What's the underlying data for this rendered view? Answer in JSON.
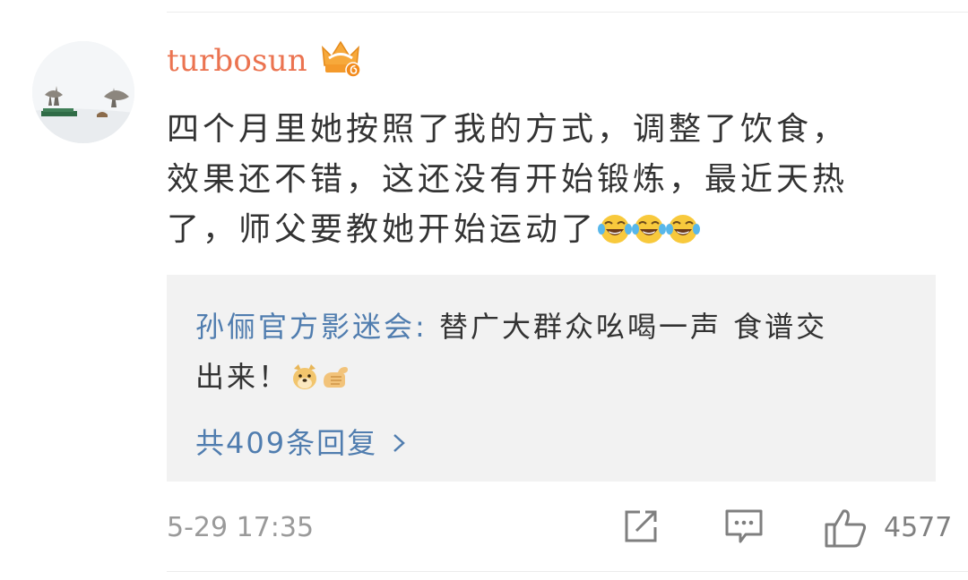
{
  "comment": {
    "username": "turbosun",
    "badge_icon": "crown-vip-badge-icon",
    "text_lines": [
      "四个月里她按照了我的方式，调整了饮食，",
      "效果还不错，这还没有开始锻炼，最近天热",
      "了，师父要教她开始运动了"
    ],
    "text_emojis": [
      "laughing-tears-icon",
      "laughing-tears-icon",
      "laughing-tears-icon"
    ]
  },
  "reply": {
    "author": "孙俪官方影迷会",
    "separator": ":",
    "text_line1": " 替广大群众吆喝一声 食谱交",
    "text_line2": "出来！",
    "emojis": [
      "doge-icon",
      "fist-salute-icon"
    ],
    "more_label": "共409条回复",
    "more_chevron": "chevron-right-icon"
  },
  "footer": {
    "timestamp": "5-29 17:35",
    "actions": [
      "share-icon",
      "comment-icon",
      "like-icon"
    ],
    "like_count": "4577"
  },
  "colors": {
    "username": "#eb7350",
    "link": "#507daf",
    "text": "#333333",
    "meta": "#9a9a9a",
    "reply_bg": "#f2f2f2"
  }
}
